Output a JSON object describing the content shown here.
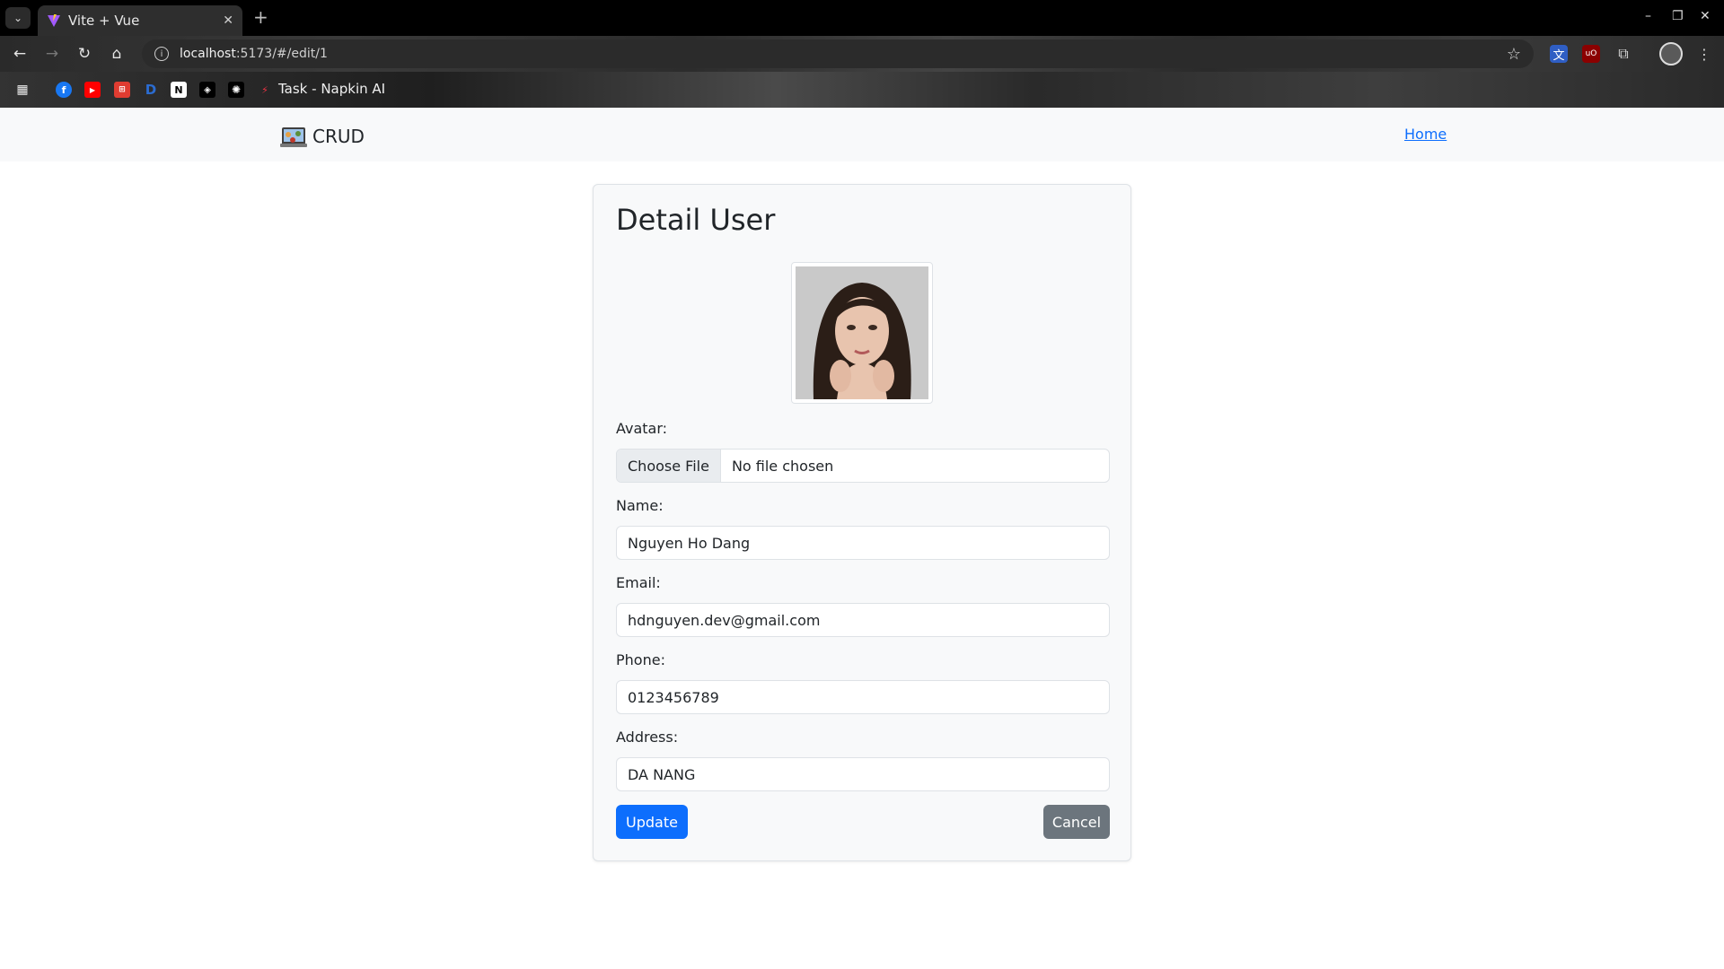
{
  "browser": {
    "tab_title": "Vite + Vue",
    "tab_close": "✕",
    "new_tab": "+",
    "url_host": "localhost",
    "url_rest": ":5173/#/edit/1",
    "bookmark_label": "Task - Napkin AI",
    "window_controls": [
      "–",
      "❐",
      "✕"
    ]
  },
  "app": {
    "brand": "CRUD",
    "nav_link": "Home"
  },
  "form": {
    "title": "Detail User",
    "avatar_label": "Avatar:",
    "file_button": "Choose File",
    "file_status": "No file chosen",
    "name_label": "Name:",
    "name_value": "Nguyen Ho Dang",
    "email_label": "Email:",
    "email_value": "hdnguyen.dev@gmail.com",
    "phone_label": "Phone:",
    "phone_value": "0123456789",
    "address_label": "Address:",
    "address_value": "DA NANG",
    "update_button": "Update",
    "cancel_button": "Cancel"
  },
  "colors": {
    "primary": "#0d6efd",
    "secondary": "#6c757d",
    "nav_bg": "#f8f9fa"
  }
}
